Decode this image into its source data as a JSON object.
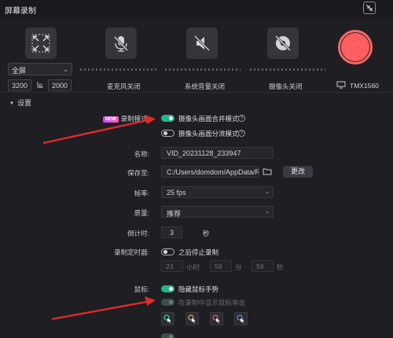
{
  "window": {
    "title": "屏幕录制"
  },
  "capture": {
    "mode": "全屏",
    "width": "3200",
    "height": "2000"
  },
  "devices": {
    "mic_label": "麦克风关闭",
    "system_audio_label": "系统音量关闭",
    "camera_label": "摄像头关闭"
  },
  "monitor": {
    "name": "TMX1560"
  },
  "settings": {
    "header": "设置",
    "record_mode": {
      "label": "录制模式:",
      "badge": "NEW",
      "option1": "摄像头画面合并模式",
      "option2": "摄像头画面分流模式",
      "help": "?"
    },
    "name": {
      "label": "名称:",
      "value": "VID_20231128_233947"
    },
    "save_to": {
      "label": "保存至:",
      "value": "C:/Users/domdom/AppData/Roa",
      "change_button": "更改"
    },
    "frame_rate": {
      "label": "帧率:",
      "value": "25 fps"
    },
    "quality": {
      "label": "质量:",
      "value": "推荐"
    },
    "countdown": {
      "label": "倒计时:",
      "value": "3",
      "unit": "秒"
    },
    "timer": {
      "label": "录制定时器:",
      "toggle_text": "之后停止录制",
      "hours": "23",
      "hours_unit": "小时",
      "minutes": "59",
      "minutes_unit": "分",
      "seconds": "59",
      "seconds_unit": "秒"
    },
    "mouse": {
      "label": "鼠标:",
      "hide_cursor": "隐藏鼠标手势",
      "show_clicks": "在录制中显示鼠标单击"
    }
  },
  "colors": {
    "accent_green": "#27b38a",
    "record_red": "#ff5f5f",
    "annotation_arrow": "#e02b2b",
    "cursor_colors": [
      "#39d98a",
      "#f5a15a",
      "#ff5b5b",
      "#6f7dff"
    ]
  }
}
